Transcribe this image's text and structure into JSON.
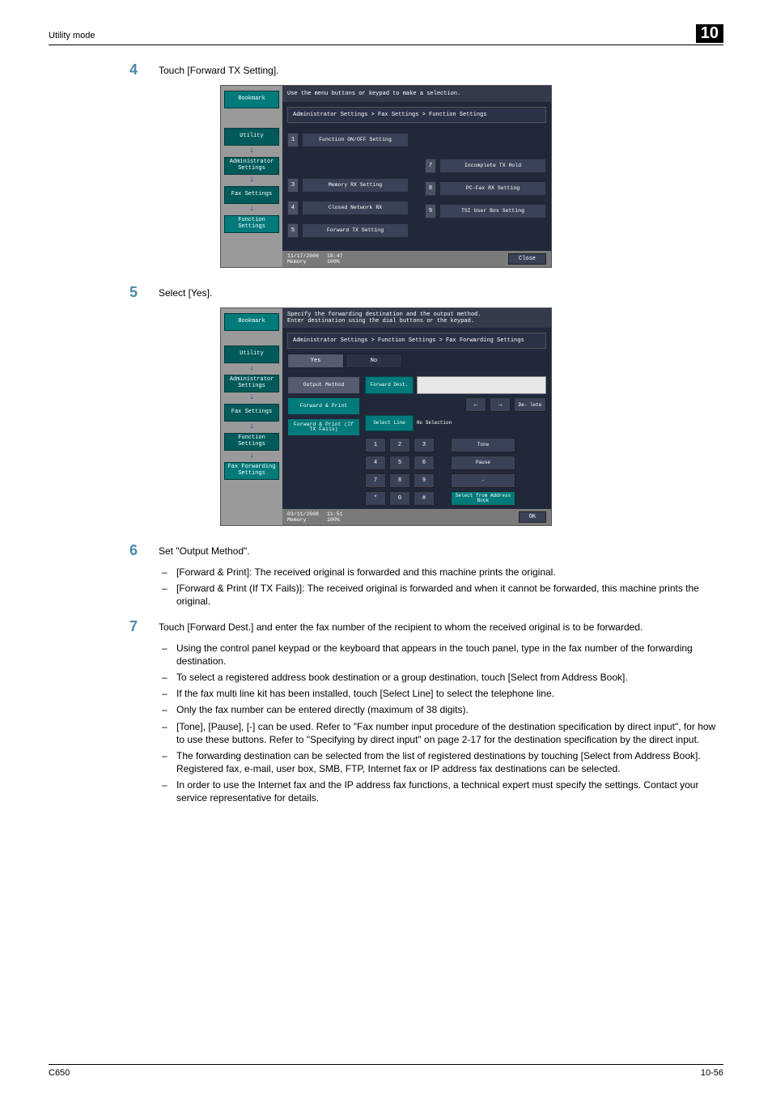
{
  "header": {
    "title": "Utility mode",
    "chapter": "10"
  },
  "footer": {
    "left": "C650",
    "right": "10-56"
  },
  "steps": {
    "s4": {
      "num": "4",
      "text": "Touch [Forward TX Setting]."
    },
    "s5": {
      "num": "5",
      "text": "Select [Yes]."
    },
    "s6": {
      "num": "6",
      "text": "Set \"Output Method\".",
      "subs": [
        "[Forward & Print]: The received original is forwarded and this machine prints the original.",
        "[Forward & Print (If TX Fails)]: The received original is forwarded and when it cannot be forwarded, this machine prints the original."
      ]
    },
    "s7": {
      "num": "7",
      "text": "Touch [Forward Dest.] and enter the fax number of the recipient to whom the received original is to be forwarded.",
      "subs": [
        "Using the control panel keypad or the keyboard that appears in the touch panel, type in the fax number of the forwarding destination.",
        "To select a registered address book destination or a group destination, touch [Select from Address Book].",
        "If the fax multi line kit has been installed, touch [Select Line] to select the telephone line.",
        "Only the fax number can be entered directly (maximum of 38 digits).",
        "[Tone], [Pause], [-] can be used. Refer to \"Fax number input procedure of the destination specification by direct input\", for how to use these buttons. Refer to \"Specifying by direct input\" on page 2-17 for the destination specification by the direct input.",
        "The forwarding destination can be selected from the list of registered destinations by touching [Select from Address Book]. Registered fax, e-mail, user box, SMB, FTP, Internet fax or IP address fax destinations can be selected.",
        "In order to use the Internet fax and the IP address fax functions, a technical expert must specify the settings. Contact your service representative for details."
      ]
    }
  },
  "shot1": {
    "instruction": "Use the menu buttons or keypad to make a selection.",
    "breadcrumb": "Administrator Settings > Fax Settings > Function Settings",
    "left": {
      "bookmark": "Bookmark",
      "utility": "Utility",
      "admin": "Administrator Settings",
      "fax": "Fax Settings",
      "func": "Function Settings"
    },
    "opts": {
      "n1": "1",
      "l1": "Function ON/OFF Setting",
      "n3": "3",
      "l3": "Memory RX Setting",
      "n4": "4",
      "l4": "Closed Network RX",
      "n5": "5",
      "l5": "Forward TX Setting",
      "n7": "7",
      "l7": "Incomplete TX Hold",
      "n8": "8",
      "l8": "PC-Fax RX Setting",
      "n9": "9",
      "l9": "TSI User Box Setting"
    },
    "footer": {
      "date": "11/17/2006",
      "time": "18:47",
      "mem": "Memory",
      "pct": "100%",
      "close": "Close"
    }
  },
  "shot2": {
    "line1": "Specify the forwarding destination and the output method.",
    "line2": "Enter destination using the dial buttons or the keypad.",
    "breadcrumb": "Administrator Settings > Function Settings > Fax Forwarding Settings",
    "left": {
      "bookmark": "Bookmark",
      "utility": "Utility",
      "admin": "Administrator Settings",
      "fax": "Fax Settings",
      "func": "Function Settings",
      "fwd": "Fax Forwarding Settings"
    },
    "yn": {
      "yes": "Yes",
      "no": "No"
    },
    "cfg_left": {
      "output": "Output Method",
      "fp": "Forward & Print",
      "fpf": "Forward & Print (If TX Fails)"
    },
    "cfg_right": {
      "fwd_dest": "Forward Dest.",
      "delete": "De- lete",
      "select_line": "Select Line",
      "no_sel": "No Selection",
      "keys": {
        "k1": "1",
        "k2": "2",
        "k3": "3",
        "k4": "4",
        "k5": "5",
        "k6": "6",
        "k7": "7",
        "k8": "8",
        "k9": "9",
        "ks": "*",
        "k0": "0",
        "kh": "#"
      },
      "side": {
        "tone": "Tone",
        "pause": "Pause",
        "dash": "-",
        "addr": "Select from Address Book"
      }
    },
    "footer": {
      "date": "03/11/2008",
      "time": "11:51",
      "mem": "Memory",
      "pct": "100%",
      "ok": "OK"
    }
  }
}
